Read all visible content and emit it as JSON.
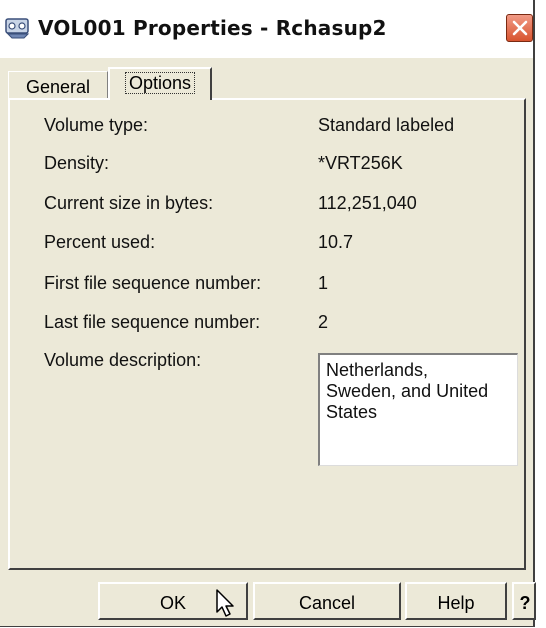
{
  "window": {
    "title": "VOL001 Properties - Rchasup2"
  },
  "tabs": [
    {
      "label": "General",
      "selected": false
    },
    {
      "label": "Options",
      "selected": true
    }
  ],
  "properties": [
    {
      "label": "Volume type:",
      "value": "Standard labeled"
    },
    {
      "label": "Density:",
      "value": "*VRT256K"
    },
    {
      "label": "Current size in bytes:",
      "value": "112,251,040"
    },
    {
      "label": "Percent used:",
      "value": "10.7"
    },
    {
      "label": "First file sequence number:",
      "value": "1"
    },
    {
      "label": "Last file sequence number:",
      "value": "2"
    }
  ],
  "description": {
    "label": "Volume description:",
    "lines": [
      "Netherlands,",
      "Sweden, and United",
      "States"
    ]
  },
  "buttons": {
    "ok": "OK",
    "cancel": "Cancel",
    "help": "Help",
    "whats_this": "?"
  },
  "icons": {
    "title": "tape-volume-icon",
    "close": "close-icon",
    "cursor": "mouse-pointer-icon"
  },
  "colors": {
    "close_button": "#d8542f",
    "dialog_background": "#ece9d8"
  }
}
